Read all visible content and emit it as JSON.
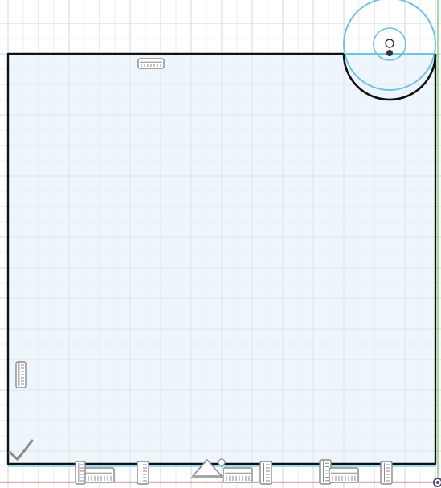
{
  "canvas": {
    "background_color": "#ffffff",
    "grid_minor_color": "#e3e8ec",
    "grid_major_color": "#d2d9df",
    "y_axis_color": "#3fbf3f",
    "x_axis_color": "#e05050"
  },
  "sketch": {
    "fill_color": "#eef6fc",
    "profile_line_color": "#111111",
    "construction_line_color": "#6cc3e6",
    "constraint_icon_color": "#8a8a8a",
    "point_color": "#333333"
  },
  "constraint_icons": [
    {
      "name": "horizontal-constraint-icon",
      "kind": "horizontal"
    },
    {
      "name": "vertical-constraint-icon",
      "kind": "vertical"
    },
    {
      "name": "fix-constraint-icon",
      "kind": "fix"
    },
    {
      "name": "horizontal-constraint-icon",
      "kind": "horizontal"
    },
    {
      "name": "vertical-constraint-icon",
      "kind": "vertical"
    },
    {
      "name": "tangent-constraint-icon",
      "kind": "tangent"
    },
    {
      "name": "horizontal-constraint-icon",
      "kind": "horizontal"
    },
    {
      "name": "vertical-constraint-icon",
      "kind": "vertical"
    },
    {
      "name": "vertical-constraint-icon",
      "kind": "vertical"
    },
    {
      "name": "horizontal-constraint-icon",
      "kind": "horizontal"
    },
    {
      "name": "vertical-constraint-icon",
      "kind": "vertical"
    },
    {
      "name": "vertical-constraint-icon",
      "kind": "vertical"
    }
  ]
}
